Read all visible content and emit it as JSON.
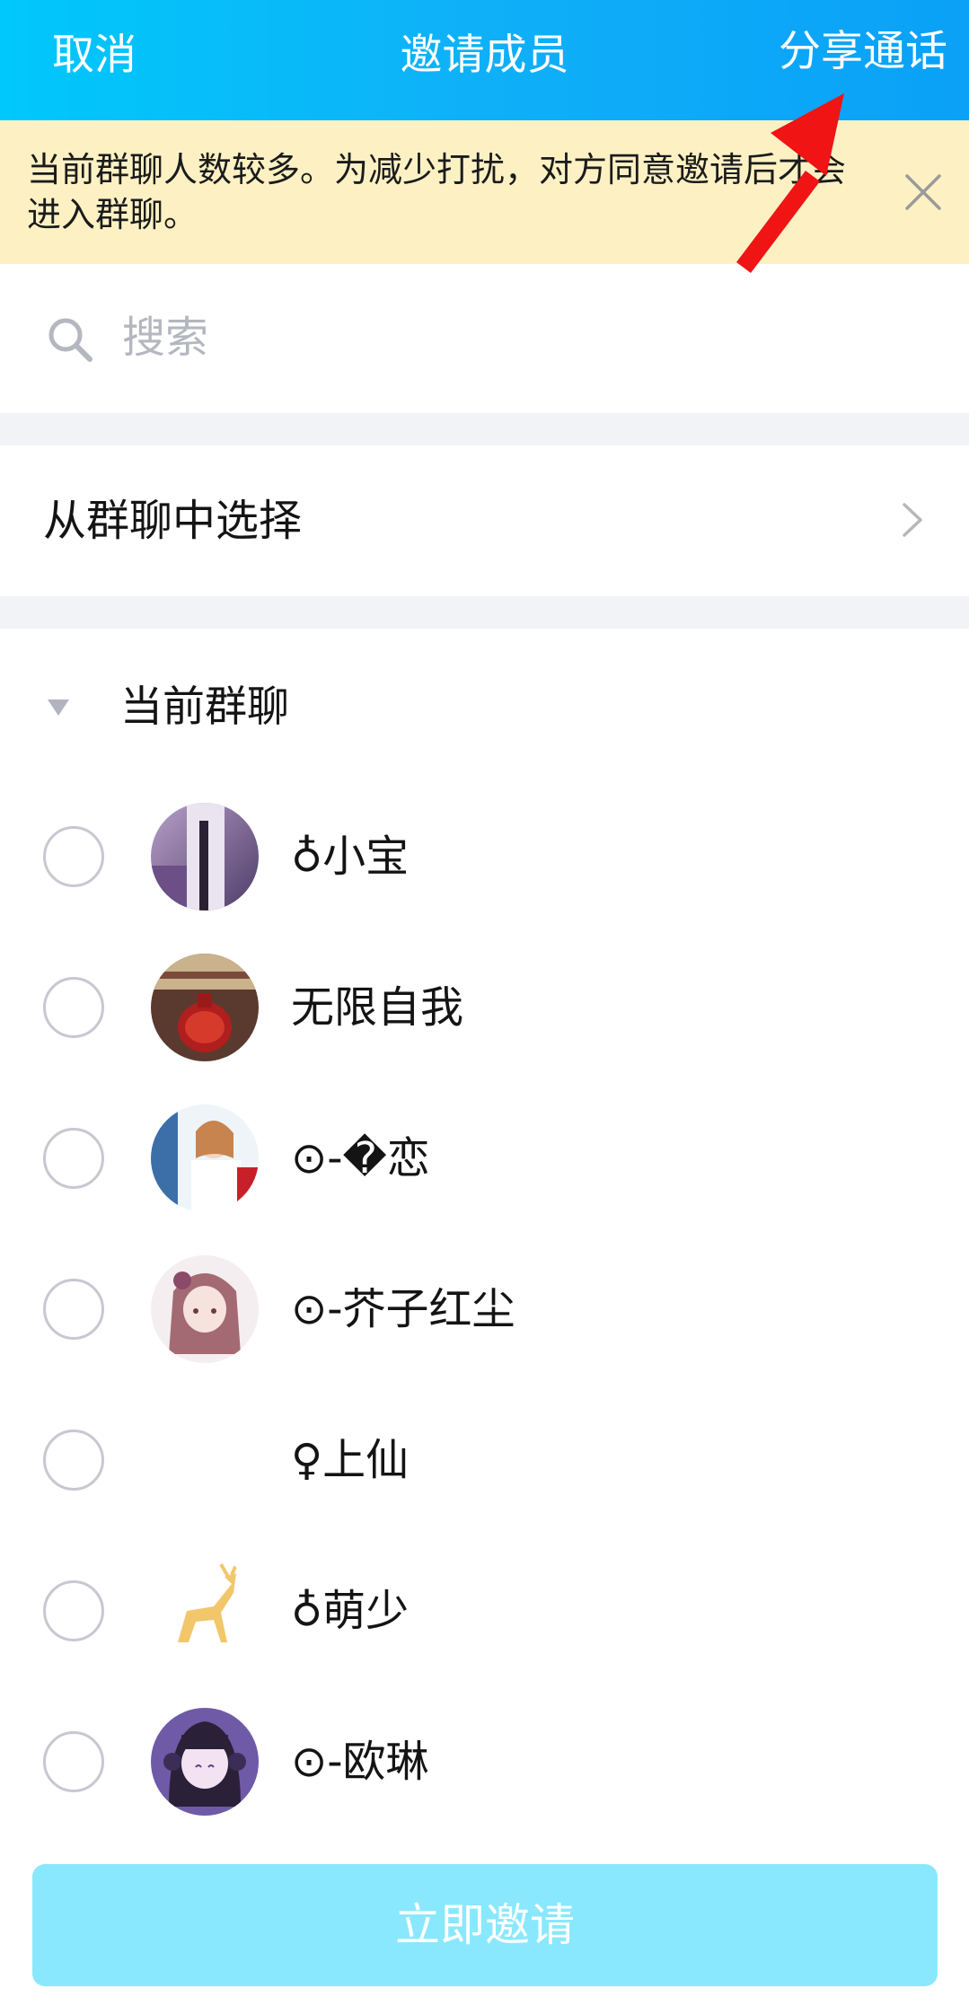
{
  "header": {
    "cancel_label": "取消",
    "title": "邀请成员",
    "share_label": "分享通话",
    "background_color": "#0fb0f8"
  },
  "notice": {
    "text": "当前群聊人数较多。为减少打扰，对方同意邀请后才会进入群聊。",
    "background_color": "#fdf1c4"
  },
  "search": {
    "placeholder": "搜索"
  },
  "from_group": {
    "label": "从群聊中选择"
  },
  "current_group": {
    "label": "当前群聊",
    "expanded": true,
    "members": [
      {
        "name": "♁小宝",
        "avatar": "photo-person",
        "selected": false
      },
      {
        "name": "无限自我",
        "avatar": "photo-vase",
        "selected": false
      },
      {
        "name": "⊙-�恋",
        "avatar": "photo-girl",
        "selected": false
      },
      {
        "name": "⊙-芥子红尘",
        "avatar": "anime-girl-pink",
        "selected": false
      },
      {
        "name": "♀上仙",
        "avatar": "blank",
        "selected": false
      },
      {
        "name": "♁萌少",
        "avatar": "golden-deer",
        "selected": false
      },
      {
        "name": "⊙-欧琳",
        "avatar": "anime-girl-purple",
        "selected": false
      }
    ]
  },
  "invite_button": {
    "label": "立即邀请",
    "enabled": false,
    "color": "#89e8fd"
  },
  "annotation": {
    "arrow_color": "#f01414"
  }
}
